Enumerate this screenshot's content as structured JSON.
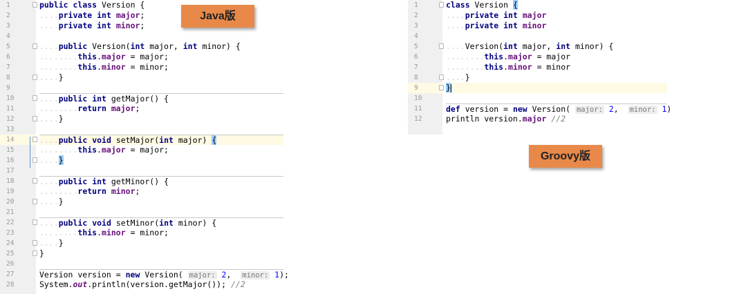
{
  "labels": {
    "java": "Java版",
    "groovy": "Groovy版"
  },
  "java": {
    "lines": [
      {
        "n": "1",
        "fold": true,
        "tokens": [
          [
            "kw",
            "public"
          ],
          [
            "t",
            " "
          ],
          [
            "kw",
            "class"
          ],
          [
            "t",
            " Version {"
          ]
        ]
      },
      {
        "n": "2",
        "tokens": [
          [
            "ws",
            "...."
          ],
          [
            "kw",
            "private"
          ],
          [
            "t",
            " "
          ],
          [
            "kw",
            "int"
          ],
          [
            "t",
            " "
          ],
          [
            "fld",
            "major"
          ],
          [
            "t",
            ";"
          ]
        ]
      },
      {
        "n": "3",
        "tokens": [
          [
            "ws",
            "...."
          ],
          [
            "kw",
            "private"
          ],
          [
            "t",
            " "
          ],
          [
            "kw",
            "int"
          ],
          [
            "t",
            " "
          ],
          [
            "fld",
            "minor"
          ],
          [
            "t",
            ";"
          ]
        ]
      },
      {
        "n": "4",
        "tokens": []
      },
      {
        "n": "5",
        "fold": true,
        "tokens": [
          [
            "ws",
            "...."
          ],
          [
            "kw",
            "public"
          ],
          [
            "t",
            " Version("
          ],
          [
            "kw",
            "int"
          ],
          [
            "t",
            " major, "
          ],
          [
            "kw",
            "int"
          ],
          [
            "t",
            " minor) {"
          ]
        ]
      },
      {
        "n": "6",
        "tokens": [
          [
            "ws",
            "........"
          ],
          [
            "kw",
            "this"
          ],
          [
            "t",
            "."
          ],
          [
            "fld",
            "major"
          ],
          [
            "t",
            " = major;"
          ]
        ]
      },
      {
        "n": "7",
        "tokens": [
          [
            "ws",
            "........"
          ],
          [
            "kw",
            "this"
          ],
          [
            "t",
            "."
          ],
          [
            "fld",
            "minor"
          ],
          [
            "t",
            " = minor;"
          ]
        ]
      },
      {
        "n": "8",
        "fold": true,
        "tokens": [
          [
            "ws",
            "...."
          ],
          [
            "t",
            "}"
          ]
        ]
      },
      {
        "n": "9",
        "tokens": []
      },
      {
        "n": "10",
        "fold": true,
        "sep": true,
        "tokens": [
          [
            "ws",
            "...."
          ],
          [
            "kw",
            "public"
          ],
          [
            "t",
            " "
          ],
          [
            "kw",
            "int"
          ],
          [
            "t",
            " getMajor() {"
          ]
        ]
      },
      {
        "n": "11",
        "tokens": [
          [
            "ws",
            "........"
          ],
          [
            "kw",
            "return"
          ],
          [
            "t",
            " "
          ],
          [
            "fld",
            "major"
          ],
          [
            "t",
            ";"
          ]
        ]
      },
      {
        "n": "12",
        "fold": true,
        "tokens": [
          [
            "ws",
            "...."
          ],
          [
            "t",
            "}"
          ]
        ]
      },
      {
        "n": "13",
        "tokens": []
      },
      {
        "n": "14",
        "fold": true,
        "sep": true,
        "hl": true,
        "tokens": [
          [
            "ws",
            "...."
          ],
          [
            "kw",
            "public"
          ],
          [
            "t",
            " "
          ],
          [
            "kw",
            "void"
          ],
          [
            "t",
            " setMajor("
          ],
          [
            "kw",
            "int"
          ],
          [
            "t",
            " major) "
          ],
          [
            "bm",
            "{"
          ]
        ]
      },
      {
        "n": "15",
        "tokens": [
          [
            "ws",
            "........"
          ],
          [
            "kw",
            "this"
          ],
          [
            "t",
            "."
          ],
          [
            "fld",
            "major"
          ],
          [
            "t",
            " = major;"
          ]
        ]
      },
      {
        "n": "16",
        "fold": true,
        "tokens": [
          [
            "ws",
            "...."
          ],
          [
            "bm",
            "}"
          ]
        ]
      },
      {
        "n": "17",
        "tokens": []
      },
      {
        "n": "18",
        "fold": true,
        "sep": true,
        "tokens": [
          [
            "ws",
            "...."
          ],
          [
            "kw",
            "public"
          ],
          [
            "t",
            " "
          ],
          [
            "kw",
            "int"
          ],
          [
            "t",
            " getMinor() {"
          ]
        ]
      },
      {
        "n": "19",
        "tokens": [
          [
            "ws",
            "........"
          ],
          [
            "kw",
            "return"
          ],
          [
            "t",
            " "
          ],
          [
            "fld",
            "minor"
          ],
          [
            "t",
            ";"
          ]
        ]
      },
      {
        "n": "20",
        "fold": true,
        "tokens": [
          [
            "ws",
            "...."
          ],
          [
            "t",
            "}"
          ]
        ]
      },
      {
        "n": "21",
        "tokens": []
      },
      {
        "n": "22",
        "fold": true,
        "sep": true,
        "tokens": [
          [
            "ws",
            "...."
          ],
          [
            "kw",
            "public"
          ],
          [
            "t",
            " "
          ],
          [
            "kw",
            "void"
          ],
          [
            "t",
            " setMinor("
          ],
          [
            "kw",
            "int"
          ],
          [
            "t",
            " minor) {"
          ]
        ]
      },
      {
        "n": "23",
        "tokens": [
          [
            "ws",
            "........"
          ],
          [
            "kw",
            "this"
          ],
          [
            "t",
            "."
          ],
          [
            "fld",
            "minor"
          ],
          [
            "t",
            " = minor;"
          ]
        ]
      },
      {
        "n": "24",
        "fold": true,
        "tokens": [
          [
            "ws",
            "...."
          ],
          [
            "t",
            "}"
          ]
        ]
      },
      {
        "n": "25",
        "fold": true,
        "tokens": [
          [
            "t",
            "}"
          ]
        ]
      },
      {
        "n": "26",
        "tokens": []
      },
      {
        "n": "27",
        "sep": true,
        "tokens": [
          [
            "t",
            "Version version = "
          ],
          [
            "kw",
            "new"
          ],
          [
            "t",
            " Version( "
          ],
          [
            "hint",
            "major:"
          ],
          [
            "t",
            " "
          ],
          [
            "num",
            "2"
          ],
          [
            "t",
            ",  "
          ],
          [
            "hint",
            "minor:"
          ],
          [
            "t",
            " "
          ],
          [
            "num",
            "1"
          ],
          [
            "t",
            ");"
          ]
        ]
      },
      {
        "n": "28",
        "tokens": [
          [
            "t",
            "System."
          ],
          [
            "sfld",
            "out"
          ],
          [
            "t",
            ".println(version.getMajor()); "
          ],
          [
            "cmt",
            "//2"
          ]
        ]
      }
    ]
  },
  "groovy": {
    "lines": [
      {
        "n": "1",
        "fold": true,
        "tokens": [
          [
            "kw",
            "class"
          ],
          [
            "t",
            " Version "
          ],
          [
            "bm",
            "{"
          ]
        ]
      },
      {
        "n": "2",
        "tokens": [
          [
            "ws",
            "...."
          ],
          [
            "kw",
            "private"
          ],
          [
            "t",
            " "
          ],
          [
            "kw",
            "int"
          ],
          [
            "t",
            " "
          ],
          [
            "fld",
            "major"
          ]
        ]
      },
      {
        "n": "3",
        "tokens": [
          [
            "ws",
            "...."
          ],
          [
            "kw",
            "private"
          ],
          [
            "t",
            " "
          ],
          [
            "kw",
            "int"
          ],
          [
            "t",
            " "
          ],
          [
            "fld",
            "minor"
          ]
        ]
      },
      {
        "n": "4",
        "tokens": []
      },
      {
        "n": "5",
        "fold": true,
        "tokens": [
          [
            "ws",
            "...."
          ],
          [
            "t",
            "Version("
          ],
          [
            "kw",
            "int"
          ],
          [
            "t",
            " major, "
          ],
          [
            "kw",
            "int"
          ],
          [
            "t",
            " minor) {"
          ]
        ]
      },
      {
        "n": "6",
        "tokens": [
          [
            "ws",
            "........"
          ],
          [
            "kw",
            "this"
          ],
          [
            "t",
            "."
          ],
          [
            "fld",
            "major"
          ],
          [
            "t",
            " = major"
          ]
        ]
      },
      {
        "n": "7",
        "tokens": [
          [
            "ws",
            "........"
          ],
          [
            "kw",
            "this"
          ],
          [
            "t",
            "."
          ],
          [
            "fld",
            "minor"
          ],
          [
            "t",
            " = minor"
          ]
        ]
      },
      {
        "n": "8",
        "fold": true,
        "tokens": [
          [
            "ws",
            "...."
          ],
          [
            "t",
            "}"
          ]
        ]
      },
      {
        "n": "9",
        "fold": true,
        "hl": true,
        "tokens": [
          [
            "bm",
            "}"
          ],
          [
            "caret",
            ""
          ]
        ]
      },
      {
        "n": "10",
        "tokens": []
      },
      {
        "n": "11",
        "sep": true,
        "tokens": [
          [
            "kw",
            "def"
          ],
          [
            "t",
            " version = "
          ],
          [
            "kw",
            "new"
          ],
          [
            "t",
            " Version( "
          ],
          [
            "hint",
            "major:"
          ],
          [
            "t",
            " "
          ],
          [
            "num",
            "2"
          ],
          [
            "t",
            ",  "
          ],
          [
            "hint",
            "minor:"
          ],
          [
            "t",
            " "
          ],
          [
            "num",
            "1"
          ],
          [
            "t",
            ")"
          ]
        ]
      },
      {
        "n": "12",
        "tokens": [
          [
            "t",
            "println version."
          ],
          [
            "fld",
            "major"
          ],
          [
            "t",
            " "
          ],
          [
            "cmt",
            "//2"
          ]
        ]
      }
    ]
  }
}
